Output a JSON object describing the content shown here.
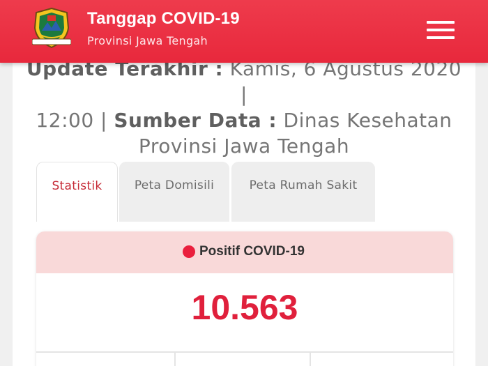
{
  "header": {
    "title": "Tanggap COVID-19",
    "subtitle": "Provinsi Jawa Tengah"
  },
  "update": {
    "label_update": "Update Terakhir :",
    "date": "Kamis, 6 Agustus 2020 |",
    "time": "12:00 |",
    "label_source": "Sumber Data :",
    "source": "Dinas Kesehatan Provinsi Jawa Tengah"
  },
  "tabs": [
    {
      "label": "Statistik",
      "active": true
    },
    {
      "label": "Peta Domisili",
      "active": false
    },
    {
      "label": "Peta Rumah Sakit",
      "active": false
    }
  ],
  "stat": {
    "label": "Positif COVID-19",
    "value": "10.563"
  },
  "colors": {
    "brand_red": "#e8283c",
    "positive_red": "#e0203c",
    "stat_header_bg": "#f9d9d9"
  }
}
